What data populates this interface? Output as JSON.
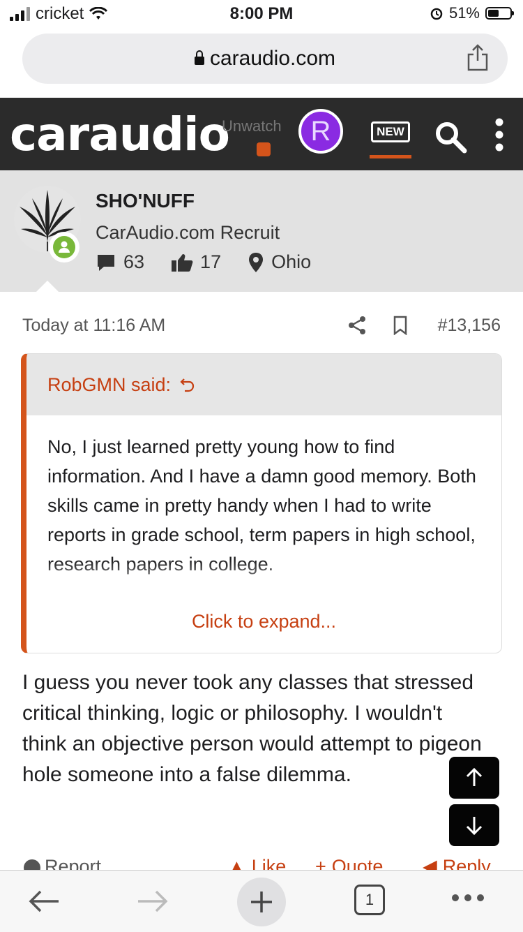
{
  "status_bar": {
    "carrier": "cricket",
    "time": "8:00 PM",
    "battery": "51%"
  },
  "browser": {
    "url": "caraudio.com",
    "tabs_count": "1"
  },
  "site": {
    "logo": "caraudio",
    "unwatch_label": "Unwatch",
    "avatar_letter": "R",
    "new_label": "NEW"
  },
  "user": {
    "name": "SHO'NUFF",
    "title": "CarAudio.com Recruit",
    "messages": "63",
    "likes": "17",
    "location": "Ohio"
  },
  "post": {
    "time": "Today at 11:16 AM",
    "number": "#13,156",
    "quote_author": "RobGMN said:",
    "quote_text": "No, I just learned pretty young how to find information. And I have a damn good memory. Both skills came in pretty handy when I had to write reports in grade school, term papers in high school, research papers in college.",
    "expand_label": "Click to expand...",
    "body": "I guess you never took any classes that stressed critical thinking, logic or philosophy. I wouldn't think an objective person would attempt to pigeon hole someone into a false dilemma."
  },
  "actions": {
    "report": "Report",
    "like": "Like",
    "quote": "Quote",
    "reply": "Reply"
  },
  "colors": {
    "accent": "#d4541b",
    "quote_text": "#c63f11",
    "header_bg": "#2b2b2b",
    "user_bg": "#e2e2e2",
    "online": "#79b83a",
    "avatar": "#8a2be2"
  }
}
